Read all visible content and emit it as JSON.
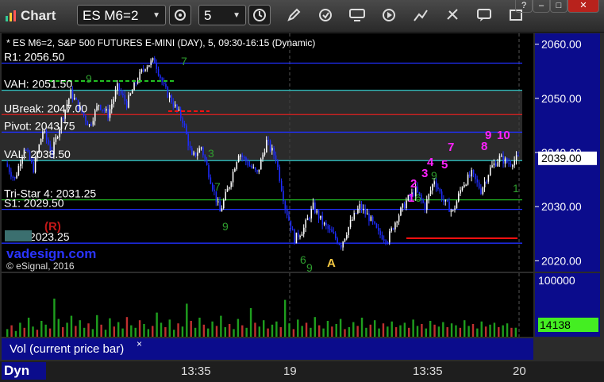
{
  "toolbar": {
    "app_title": "Chart",
    "symbol": "ES M6=2",
    "interval": "5",
    "window_controls": [
      "?",
      "–",
      "□",
      "✕"
    ]
  },
  "chart_header": "* ES M6=2, S&P 500 FUTURES E-MINI (DAY), 5, 09:30-16:15 (Dynamic)",
  "copyright": "© eSignal, 2016",
  "watermark": "vadesign.com",
  "colors": {
    "bg": "#000000",
    "axis_bg": "#0b0c8c",
    "up": "#ffffff",
    "down": "#1e2cff",
    "vol_up": "#1e9e1e",
    "vol_down": "#c03030",
    "magenta": "#ff22ff",
    "green_text": "#33b033"
  },
  "bottom": {
    "mode": "Dyn",
    "times": [
      "13:35",
      "19",
      "13:35",
      "20"
    ]
  },
  "chart_data": [
    {
      "type": "candlestick",
      "ylim": [
        2018,
        2062
      ],
      "yticks": [
        2020,
        2030,
        2040,
        2050,
        2060
      ],
      "ytick_labels": [
        "2020.00",
        "2030.00",
        "2040.00",
        "2050.00",
        "2060.00"
      ],
      "last_price": 2039.0,
      "last_price_label": "2039.00",
      "close_path": [
        2038,
        2035,
        2041,
        2037,
        2044,
        2040,
        2046,
        2051,
        2048,
        2045,
        2049,
        2047,
        2052,
        2049,
        2053,
        2056,
        2057,
        2052,
        2049,
        2046,
        2039,
        2041,
        2035,
        2029,
        2034,
        2040,
        2038,
        2036,
        2042,
        2039,
        2030,
        2024,
        2026,
        2030,
        2027,
        2025,
        2023,
        2027,
        2030,
        2028,
        2025,
        2024,
        2028,
        2031,
        2033,
        2030,
        2035,
        2031,
        2029,
        2034,
        2036,
        2033,
        2037,
        2039,
        2038,
        2039
      ],
      "levels": [
        {
          "label": "R1: 2056.50",
          "value": 2056.5,
          "color": "#2030ff"
        },
        {
          "label": "VAH: 2051.50",
          "value": 2051.5,
          "color": "#30c8c8"
        },
        {
          "label": "UBreak: 2047.00",
          "value": 2047.0,
          "color": "#e02020"
        },
        {
          "label": "Pivot: 2043.75",
          "value": 2043.75,
          "color": "#2030ff"
        },
        {
          "label": "VAL: 2038.50",
          "value": 2038.5,
          "color": "#30c8c8"
        },
        {
          "label": "Tri-Star 4: 2031.25",
          "value": 2031.25,
          "color": "#20b020"
        },
        {
          "label": "S1: 2029.50",
          "value": 2029.5,
          "color": "#2030ff"
        },
        {
          "label": "LPT: 2023.25",
          "value": 2023.25,
          "color": "#2030ff"
        }
      ],
      "annotations": {
        "magenta": [
          "1",
          "2",
          "3",
          "4",
          "5",
          "7",
          "8",
          "9",
          "10"
        ],
        "green": [
          "9",
          "7",
          "3",
          "7",
          "6",
          "9",
          "6",
          "9",
          "9",
          "1"
        ],
        "marker_r": "(R)",
        "marker_a": "A"
      }
    },
    {
      "type": "bar",
      "title": "Vol (current price bar)",
      "ytick_labels": [
        "100000"
      ],
      "current_value_label": "14138",
      "current_value": 14138,
      "volumes": [
        12000,
        18000,
        9000,
        22000,
        14000,
        30000,
        16000,
        11000,
        25000,
        19000,
        13000,
        60000,
        28000,
        15000,
        22000,
        33000,
        17000,
        26000,
        14000,
        21000,
        12000,
        34000,
        19000,
        11000,
        29000,
        16000,
        23000,
        13000,
        31000,
        18000,
        14000,
        26000,
        20000,
        12000,
        17000,
        38000,
        22000,
        15000,
        27000,
        11000,
        21000,
        16000,
        52000,
        25000,
        14000,
        30000,
        19000,
        13000,
        24000,
        17000,
        33000,
        15000,
        20000,
        12000,
        28000,
        18000,
        14000,
        45000,
        22000,
        16000,
        26000,
        13000,
        19000,
        24000,
        15000,
        58000,
        21000,
        12000,
        27000,
        17000,
        22000,
        14000,
        31000,
        18000,
        13000,
        25000,
        16000,
        20000,
        28000,
        12000,
        15000,
        23000,
        17000,
        30000,
        14000,
        19000,
        26000,
        13000,
        21000,
        16000,
        24000,
        15000,
        18000,
        22000,
        14000,
        27000,
        17000,
        20000,
        13000,
        25000,
        19000,
        16000,
        23000,
        15000,
        21000,
        18000,
        14000,
        26000,
        17000,
        20000,
        13000,
        24000,
        16000,
        19000,
        22000,
        15000,
        18000,
        21000,
        14000,
        14138
      ]
    }
  ]
}
